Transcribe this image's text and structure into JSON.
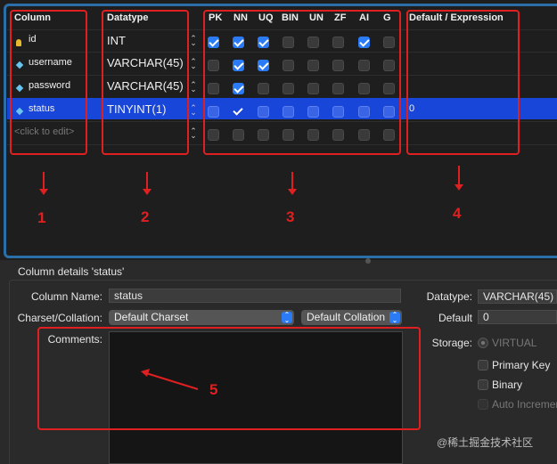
{
  "grid": {
    "headers": {
      "column": "Column",
      "datatype": "Datatype",
      "pk": "PK",
      "nn": "NN",
      "uq": "UQ",
      "bin": "BIN",
      "un": "UN",
      "zf": "ZF",
      "ai": "AI",
      "g": "G",
      "default": "Default / Expression"
    },
    "rows": [
      {
        "name": "id",
        "type": "INT",
        "icon": "key-icon",
        "default": "",
        "flags": {
          "pk": true,
          "nn": true,
          "uq": true,
          "bin": false,
          "un": false,
          "zf": false,
          "ai": true,
          "g": false
        }
      },
      {
        "name": "username",
        "type": "VARCHAR(45)",
        "icon": "column-diamond-icon",
        "default": "",
        "flags": {
          "pk": false,
          "nn": true,
          "uq": true,
          "bin": false,
          "un": false,
          "zf": false,
          "ai": false,
          "g": false
        }
      },
      {
        "name": "password",
        "type": "VARCHAR(45)",
        "icon": "column-diamond-icon",
        "default": "",
        "flags": {
          "pk": false,
          "nn": true,
          "uq": false,
          "bin": false,
          "un": false,
          "zf": false,
          "ai": false,
          "g": false
        }
      },
      {
        "name": "status",
        "type": "TINYINT(1)",
        "icon": "column-diamond-icon",
        "default": "0",
        "selected": true,
        "flags": {
          "pk": false,
          "nn": true,
          "uq": false,
          "bin": false,
          "un": false,
          "zf": false,
          "ai": false,
          "g": false
        }
      },
      {
        "name": "<click to edit>",
        "type": "",
        "icon": "",
        "default": "",
        "flags": {
          "pk": false,
          "nn": false,
          "uq": false,
          "bin": false,
          "un": false,
          "zf": false,
          "ai": false,
          "g": false
        }
      }
    ]
  },
  "annotations": {
    "n1": "1",
    "n2": "2",
    "n3": "3",
    "n4": "4",
    "n5": "5"
  },
  "details": {
    "title": "Column details 'status'",
    "column_name_label": "Column Name:",
    "column_name_value": "status",
    "charset_label": "Charset/Collation:",
    "charset_value": "Default Charset",
    "collation_value": "Default Collation",
    "comments_label": "Comments:",
    "datatype_label": "Datatype:",
    "datatype_value": "VARCHAR(45)",
    "default_label": "Default",
    "default_value": "0",
    "storage_label": "Storage:",
    "storage_virtual": "VIRTUAL",
    "primary_key": "Primary Key",
    "binary": "Binary",
    "auto_increment": "Auto Increment"
  },
  "watermark": "@稀土掘金技术社区",
  "colors": {
    "selection": "#1846d8",
    "checkbox_on": "#2a7bf5",
    "annotation": "#e02020",
    "border": "#2a6fa8"
  }
}
